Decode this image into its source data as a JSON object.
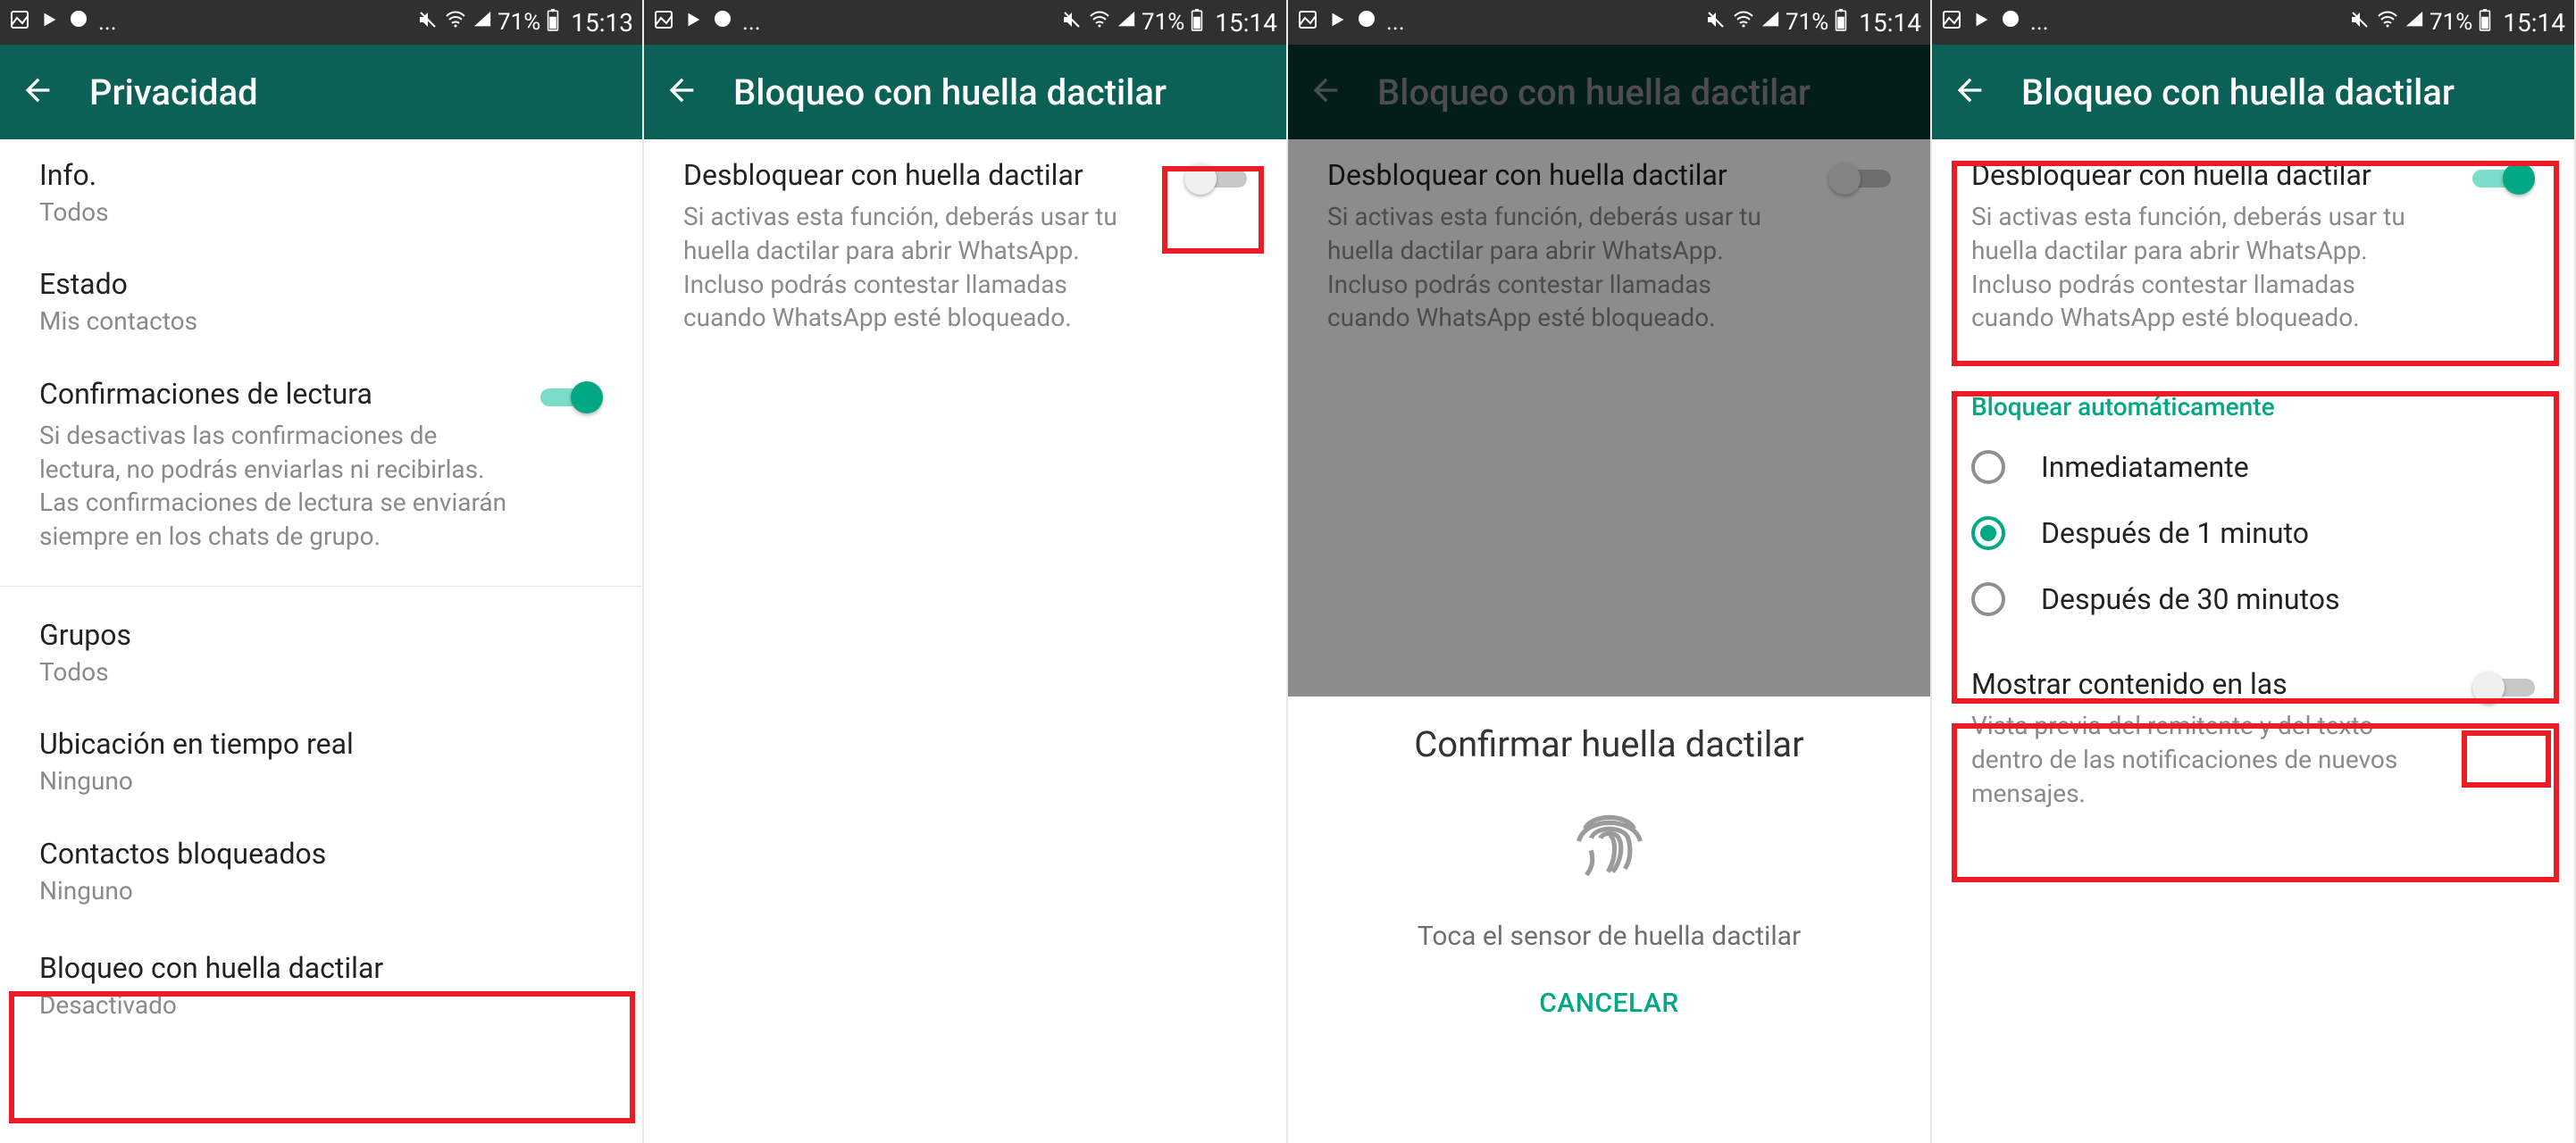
{
  "status": {
    "dots": "...",
    "battery": "71%",
    "times": [
      "15:13",
      "15:14",
      "15:14",
      "15:14"
    ]
  },
  "colors": {
    "teal": "#0b6156",
    "accent": "#00a884",
    "highlight": "#ed1c24"
  },
  "screen1": {
    "title": "Privacidad",
    "items": {
      "info": {
        "label": "Info.",
        "sub": "Todos"
      },
      "estado": {
        "label": "Estado",
        "sub": "Mis contactos"
      },
      "readreceipts": {
        "label": "Confirmaciones de lectura",
        "desc": "Si desactivas las confirmaciones de lectura, no podrás enviarlas ni recibirlas. Las confirmaciones de lectura se enviarán siempre en los chats de grupo."
      },
      "grupos": {
        "label": "Grupos",
        "sub": "Todos"
      },
      "liveloc": {
        "label": "Ubicación en tiempo real",
        "sub": "Ninguno"
      },
      "blocked": {
        "label": "Contactos bloqueados",
        "sub": "Ninguno"
      },
      "fingerprint": {
        "label": "Bloqueo con huella dactilar",
        "sub": "Desactivado"
      }
    }
  },
  "fingerprint_screen": {
    "title": "Bloqueo con huella dactilar",
    "unlock": {
      "label": "Desbloquear con huella dactilar",
      "desc": "Si activas esta función, deberás usar tu huella dactilar para abrir WhatsApp. Incluso podrás contestar llamadas cuando WhatsApp esté bloqueado."
    },
    "autolock": {
      "heading": "Bloquear automáticamente",
      "options": [
        "Inmediatamente",
        "Después de 1 minuto",
        "Después de 30 minutos"
      ]
    },
    "showcontent": {
      "label": "Mostrar contenido en las",
      "desc": "Vista previa del remitente y del texto dentro de las notificaciones de nuevos mensajes."
    }
  },
  "sheet": {
    "title": "Confirmar huella dactilar",
    "sub": "Toca el sensor de huella dactilar",
    "cancel": "CANCELAR"
  }
}
